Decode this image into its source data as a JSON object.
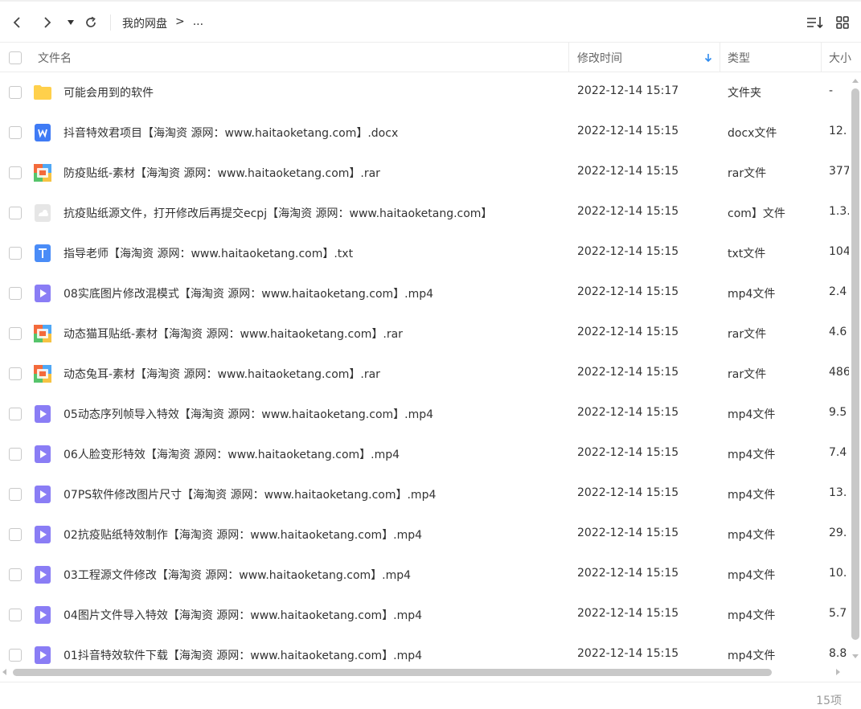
{
  "toolbar": {
    "breadcrumb": [
      "我的网盘",
      ">",
      "..."
    ]
  },
  "header": {
    "col_name": "文件名",
    "col_time": "修改时间",
    "col_type": "类型",
    "col_size": "大小"
  },
  "files": [
    {
      "icon": "folder-icon",
      "name": "可能会用到的软件",
      "time": "2022-12-14 15:17",
      "type": "文件夹",
      "size": "-"
    },
    {
      "icon": "word-doc-icon",
      "name": "抖音特效君项目【海淘资 源网：www.haitaoketang.com】.docx",
      "time": "2022-12-14 15:15",
      "type": "docx文件",
      "size": "12."
    },
    {
      "icon": "rar-archive-icon",
      "name": "防疫贴纸-素材【海淘资 源网：www.haitaoketang.com】.rar",
      "time": "2022-12-14 15:15",
      "type": "rar文件",
      "size": "377"
    },
    {
      "icon": "generic-file-icon",
      "name": "抗疫贴纸源文件，打开修改后再提交ecpj【海淘资 源网：www.haitaoketang.com】",
      "time": "2022-12-14 15:15",
      "type": "com】文件",
      "size": "1.3."
    },
    {
      "icon": "text-file-icon",
      "name": "指导老师【海淘资 源网：www.haitaoketang.com】.txt",
      "time": "2022-12-14 15:15",
      "type": "txt文件",
      "size": "104"
    },
    {
      "icon": "video-file-icon",
      "name": "08实底图片修改混模式【海淘资 源网：www.haitaoketang.com】.mp4",
      "time": "2022-12-14 15:15",
      "type": "mp4文件",
      "size": "2.4"
    },
    {
      "icon": "rar-archive-icon",
      "name": "动态猫耳贴纸-素材【海淘资 源网：www.haitaoketang.com】.rar",
      "time": "2022-12-14 15:15",
      "type": "rar文件",
      "size": "4.6"
    },
    {
      "icon": "rar-archive-icon",
      "name": "动态兔耳-素材【海淘资 源网：www.haitaoketang.com】.rar",
      "time": "2022-12-14 15:15",
      "type": "rar文件",
      "size": "486"
    },
    {
      "icon": "video-file-icon",
      "name": "05动态序列帧导入特效【海淘资 源网：www.haitaoketang.com】.mp4",
      "time": "2022-12-14 15:15",
      "type": "mp4文件",
      "size": "9.5"
    },
    {
      "icon": "video-file-icon",
      "name": "06人脸变形特效【海淘资 源网：www.haitaoketang.com】.mp4",
      "time": "2022-12-14 15:15",
      "type": "mp4文件",
      "size": "7.4"
    },
    {
      "icon": "video-file-icon",
      "name": "07PS软件修改图片尺寸【海淘资 源网：www.haitaoketang.com】.mp4",
      "time": "2022-12-14 15:15",
      "type": "mp4文件",
      "size": "13."
    },
    {
      "icon": "video-file-icon",
      "name": "02抗疫贴纸特效制作【海淘资 源网：www.haitaoketang.com】.mp4",
      "time": "2022-12-14 15:15",
      "type": "mp4文件",
      "size": "29."
    },
    {
      "icon": "video-file-icon",
      "name": "03工程源文件修改【海淘资 源网：www.haitaoketang.com】.mp4",
      "time": "2022-12-14 15:15",
      "type": "mp4文件",
      "size": "10."
    },
    {
      "icon": "video-file-icon",
      "name": "04图片文件导入特效【海淘资 源网：www.haitaoketang.com】.mp4",
      "time": "2022-12-14 15:15",
      "type": "mp4文件",
      "size": "5.7"
    },
    {
      "icon": "video-file-icon",
      "name": "01抖音特效软件下载【海淘资 源网：www.haitaoketang.com】.mp4",
      "time": "2022-12-14 15:15",
      "type": "mp4文件",
      "size": "8.8"
    }
  ],
  "footer": {
    "count": "15项"
  },
  "colors": {
    "folder": "#FFD04B",
    "word": "#3F7BF5",
    "text": "#4A8CF7",
    "video": "#8A7DF5",
    "sort_arrow": "#2E8BEF"
  }
}
